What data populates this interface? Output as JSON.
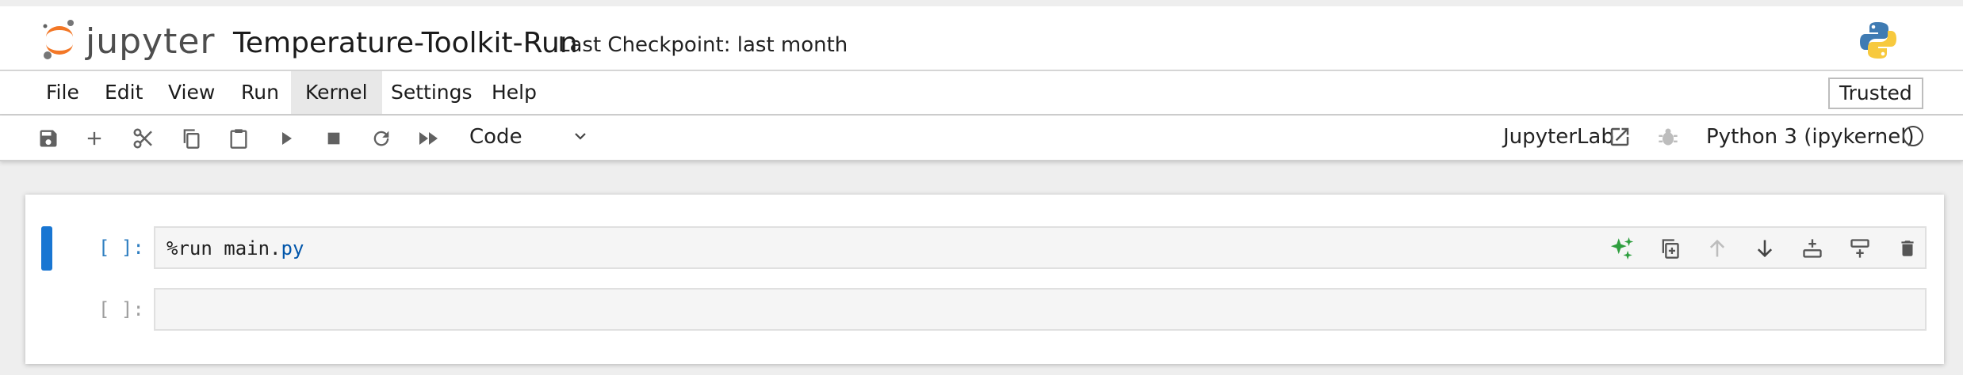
{
  "header": {
    "logo_text": "jupyter",
    "notebook_title": "Temperature-Toolkit-Run",
    "checkpoint": "Last Checkpoint: last month",
    "logo_icon": "jupyter-logo-icon",
    "kernel_logo_icon": "python-logo-icon"
  },
  "menu": {
    "items": [
      "File",
      "Edit",
      "View",
      "Run",
      "Kernel",
      "Settings",
      "Help"
    ],
    "active": "Kernel",
    "trusted_label": "Trusted"
  },
  "toolbar": {
    "buttons": [
      "save-icon",
      "add-cell-icon",
      "cut-icon",
      "copy-icon",
      "paste-icon",
      "run-icon",
      "stop-icon",
      "restart-icon",
      "fast-forward-icon"
    ],
    "cell_type": "Code",
    "open_in": "JupyterLab",
    "kernel_name": "Python 3 (ipykernel)",
    "kernel_status": "idle"
  },
  "cells": [
    {
      "prompt": "[ ]:",
      "code_plain": "%run main.",
      "code_ext": "py",
      "active": true
    },
    {
      "prompt": "[ ]:",
      "code_plain": "",
      "code_ext": "",
      "active": false
    }
  ],
  "cell_toolbar": [
    "sparkle-ai-icon",
    "duplicate-icon",
    "move-up-icon",
    "move-down-icon",
    "insert-above-icon",
    "insert-below-icon",
    "delete-icon"
  ],
  "colors": {
    "accent": "#1976d2",
    "jupyter_orange": "#f37726",
    "prompt_active": "#307fc1",
    "ai_green": "#2e9e3e"
  }
}
